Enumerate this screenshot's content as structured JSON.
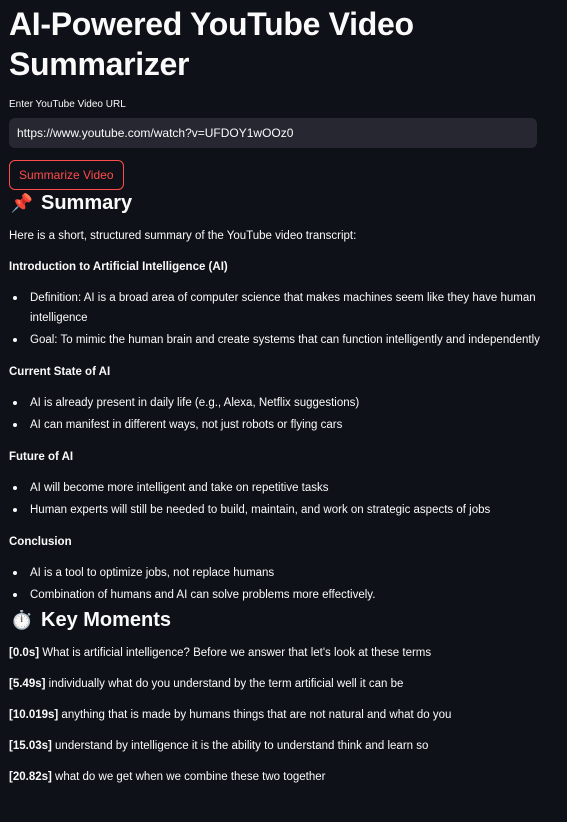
{
  "app": {
    "title": "AI-Powered YouTube Video Summarizer"
  },
  "url_input": {
    "label": "Enter YouTube Video URL",
    "value": "https://www.youtube.com/watch?v=UFDOY1wOOz0"
  },
  "buttons": {
    "summarize_label": "Summarize Video"
  },
  "summary": {
    "emoji": "📌",
    "heading": "Summary",
    "intro": "Here is a short, structured summary of the YouTube video transcript:",
    "sections": [
      {
        "title": "Introduction to Artificial Intelligence (AI)",
        "bullets": [
          "Definition: AI is a broad area of computer science that makes machines seem like they have human intelligence",
          "Goal: To mimic the human brain and create systems that can function intelligently and independently"
        ]
      },
      {
        "title": "Current State of AI",
        "bullets": [
          "AI is already present in daily life (e.g., Alexa, Netflix suggestions)",
          "AI can manifest in different ways, not just robots or flying cars"
        ]
      },
      {
        "title": "Future of AI",
        "bullets": [
          "AI will become more intelligent and take on repetitive tasks",
          "Human experts will still be needed to build, maintain, and work on strategic aspects of jobs"
        ]
      },
      {
        "title": "Conclusion",
        "bullets": [
          "AI is a tool to optimize jobs, not replace humans",
          "Combination of humans and AI can solve problems more effectively."
        ]
      }
    ]
  },
  "key_moments": {
    "emoji": "⏱️",
    "heading": "Key Moments",
    "items": [
      {
        "ts": "[0.0s]",
        "text": " What is artificial intelligence? Before we answer that let's look at these terms"
      },
      {
        "ts": "[5.49s]",
        "text": " individually what do you understand by the term artificial well it can be"
      },
      {
        "ts": "[10.019s]",
        "text": " anything that is made by humans things that are not natural and what do you"
      },
      {
        "ts": "[15.03s]",
        "text": " understand by intelligence it is the ability to understand think and learn so"
      },
      {
        "ts": "[20.82s]",
        "text": " what do we get when we combine these two together"
      }
    ]
  },
  "colors": {
    "background": "#0e1117",
    "input_background": "#262730",
    "accent": "#ff4b4b",
    "text": "#fafafa"
  }
}
